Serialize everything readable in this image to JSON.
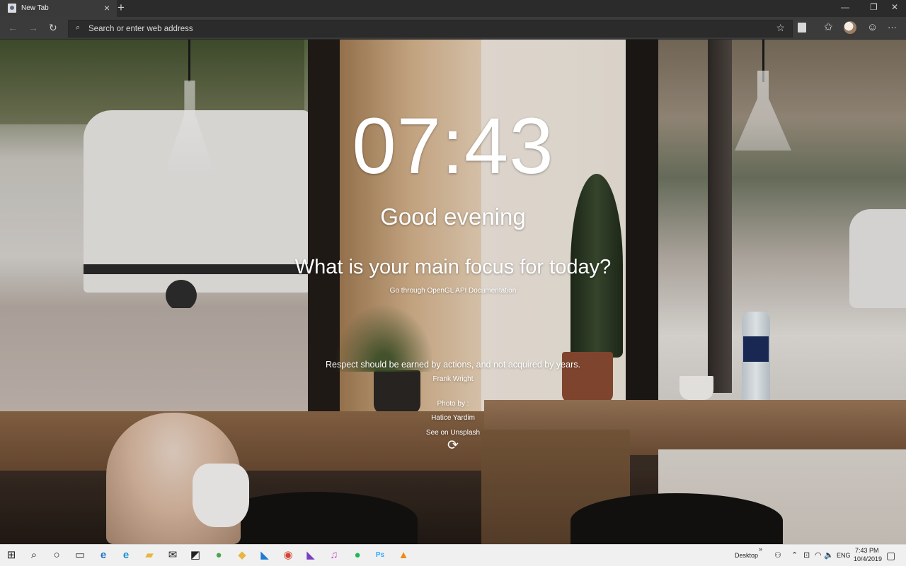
{
  "browser": {
    "tab": {
      "title": "New Tab",
      "close_glyph": "×",
      "icon": "page-icon"
    },
    "new_tab_glyph": "+",
    "window_controls": {
      "minimize": "—",
      "restore": "❐",
      "close": "✕"
    },
    "nav": {
      "back": "←",
      "forward": "→",
      "refresh": "↻"
    },
    "address_bar": {
      "placeholder": "Search or enter web address",
      "value": "",
      "search_glyph": "⌕"
    },
    "toolbar": {
      "favorite": "☆",
      "favorites_hub": "✩",
      "feedback": "☺",
      "more": "···"
    }
  },
  "dashboard": {
    "clock": "07:43",
    "greeting": "Good evening",
    "focus_question": "What is your main focus for today?",
    "focus_task": "Go through OpenGL API Documentation",
    "quote": "Respect should be earned by actions, and not acquired by years.",
    "quote_author": "Frank Wright",
    "photo_by_label": "Photo by :",
    "photographer": "Hatice Yardim",
    "unsplash_link": "See on Unsplash",
    "refresh_glyph": "⟳"
  },
  "taskbar": {
    "apps": [
      {
        "name": "start",
        "glyph": "⊞",
        "color": "#222222"
      },
      {
        "name": "search",
        "glyph": "⌕",
        "color": "#222222"
      },
      {
        "name": "cortana",
        "glyph": "○",
        "color": "#222222"
      },
      {
        "name": "task-view",
        "glyph": "▭",
        "color": "#222222"
      },
      {
        "name": "edge",
        "glyph": "e",
        "color": "#1e73c8"
      },
      {
        "name": "ie",
        "glyph": "e",
        "color": "#1a8fd0"
      },
      {
        "name": "file-explorer",
        "glyph": "▰",
        "color": "#e8b640"
      },
      {
        "name": "mail",
        "glyph": "✉",
        "color": "#333333"
      },
      {
        "name": "sticky",
        "glyph": "◩",
        "color": "#333333"
      },
      {
        "name": "app-green",
        "glyph": "●",
        "color": "#4aa64a"
      },
      {
        "name": "app-drive",
        "glyph": "◆",
        "color": "#e8b640"
      },
      {
        "name": "vscode",
        "glyph": "◣",
        "color": "#1f7ad1"
      },
      {
        "name": "chrome",
        "glyph": "◉",
        "color": "#d64235"
      },
      {
        "name": "visual-studio",
        "glyph": "◣",
        "color": "#7a3fc0"
      },
      {
        "name": "itunes",
        "glyph": "♫",
        "color": "#d04ad0"
      },
      {
        "name": "spotify",
        "glyph": "●",
        "color": "#1db954"
      },
      {
        "name": "photoshop",
        "glyph": "Ps",
        "color": "#31a8ff"
      },
      {
        "name": "vlc",
        "glyph": "▲",
        "color": "#f08a16"
      }
    ],
    "desktop_label": "Desktop",
    "chevron": "»",
    "language": "ENG",
    "time": "7:43 PM",
    "date": "10/4/2019",
    "tray": {
      "people": "⚇",
      "up": "⌃",
      "network": "⊡",
      "wifi": "◠",
      "volume": "🔈",
      "notifications": "▢"
    }
  }
}
